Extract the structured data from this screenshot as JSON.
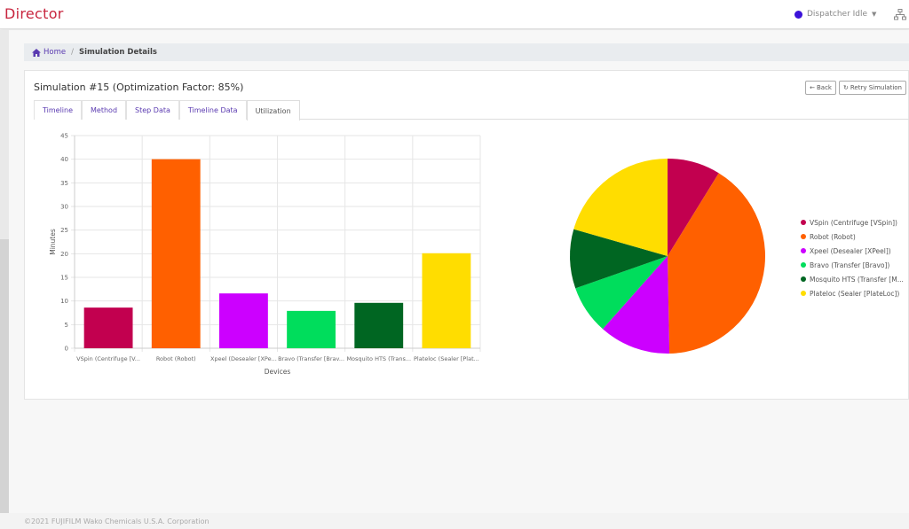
{
  "app": {
    "brand": "Director"
  },
  "topbar": {
    "dispatcher_status": "Dispatcher Idle",
    "status_color": "#3b12d9"
  },
  "breadcrumb": {
    "home": "Home",
    "separator": "/",
    "current": "Simulation Details"
  },
  "card": {
    "title": "Simulation #15 (Optimization Factor: 85%)",
    "buttons": {
      "back": "Back",
      "retry": "Retry Simulation",
      "back_icon": "←",
      "retry_icon": "↻"
    },
    "tabs": [
      {
        "label": "Timeline"
      },
      {
        "label": "Method"
      },
      {
        "label": "Step Data"
      },
      {
        "label": "Timeline Data"
      },
      {
        "label": "Utilization",
        "active": true
      }
    ]
  },
  "chart_data": [
    {
      "type": "bar",
      "title": "",
      "xlabel": "Devices",
      "ylabel": "Minutes",
      "ylim": [
        0,
        45
      ],
      "yticks": [
        0,
        5,
        10,
        15,
        20,
        25,
        30,
        35,
        40,
        45
      ],
      "grid": true,
      "categories": [
        "VSpin (Centrifuge [V...",
        "Robot (Robot)",
        "Xpeel (Desealer [XPe...",
        "Bravo (Transfer [Brav...",
        "Mosquito HTS (Trans...",
        "Plateloc (Sealer [Plat..."
      ],
      "values": [
        8.6,
        40,
        11.6,
        7.9,
        9.6,
        20.1
      ],
      "colors": [
        "#c2004f",
        "#ff6000",
        "#cc00ff",
        "#00dd5c",
        "#006622",
        "#ffdd00"
      ]
    },
    {
      "type": "pie",
      "labels": [
        "VSpin (Centrifuge [VSpin])",
        "Robot (Robot)",
        "Xpeel (Desealer [XPeel])",
        "Bravo (Transfer [Bravo])",
        "Mosquito HTS (Transfer [M...",
        "Plateloc (Sealer [PlateLoc])"
      ],
      "values": [
        8.6,
        40,
        11.6,
        7.9,
        9.6,
        20.1
      ],
      "colors": [
        "#c2004f",
        "#ff6000",
        "#cc00ff",
        "#00dd5c",
        "#006622",
        "#ffdd00"
      ],
      "legend": "right"
    }
  ],
  "footer": {
    "copyright": "©2021 FUJIFILM Wako Chemicals U.S.A. Corporation"
  }
}
